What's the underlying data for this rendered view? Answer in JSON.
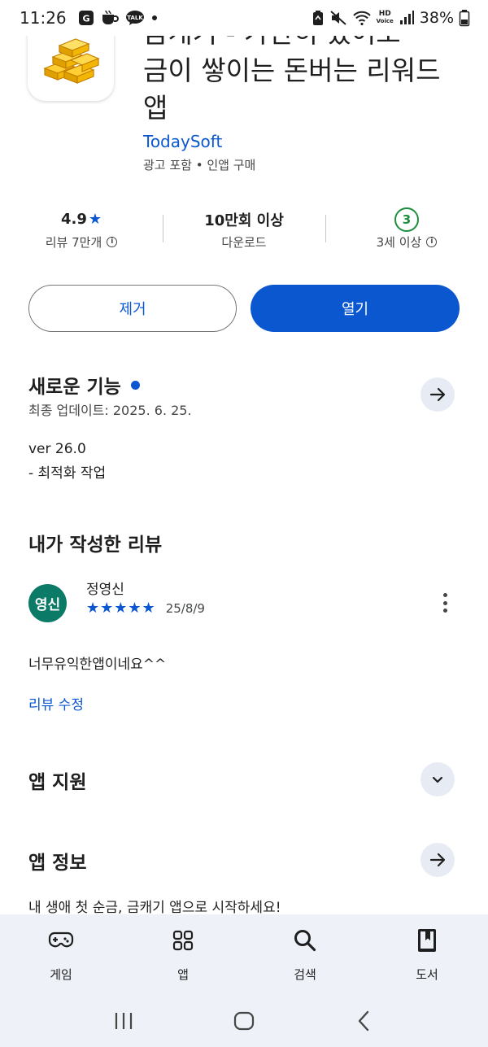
{
  "status_bar": {
    "time": "11:26",
    "notif_icons": [
      "gallery-icon",
      "coffee-icon",
      "talk-icon"
    ],
    "talk_badge": "TALK",
    "hd_badge_top": "HD",
    "hd_badge_bottom": "Voice",
    "battery_percent": "38%"
  },
  "app": {
    "title_line1": "금캐기 - 가만히 있어도",
    "title_line2": "금이 쌓이는 돈버는 리워드",
    "title_line3": "앱",
    "developer": "TodaySoft",
    "ad_info": "광고 포함 • 인앱 구매"
  },
  "stats": {
    "rating": "4.9",
    "rating_star": "★",
    "reviews_label": "리뷰 7만개",
    "downloads": "10만회 이상",
    "downloads_label": "다운로드",
    "age_rating": "3",
    "age_label": "3세 이상",
    "info_glyph": "i"
  },
  "buttons": {
    "remove": "제거",
    "open": "열기"
  },
  "whats_new": {
    "title": "새로운 기능",
    "last_updated": "최종 업데이트: 2025. 6. 25.",
    "version": "ver 26.0",
    "note": "- 최적화 작업"
  },
  "my_review": {
    "title": "내가 작성한 리뷰",
    "avatar_text": "영신",
    "reviewer": "정영신",
    "stars": "★★★★★",
    "rating_value": 5,
    "date": "25/8/9",
    "text": "너무유익한앱이네요^^",
    "edit_label": "리뷰 수정"
  },
  "app_support": {
    "title": "앱 지원"
  },
  "app_info": {
    "title": "앱 정보",
    "description": "내 생애 첫 순금, 금캐기 앱으로 시작하세요!"
  },
  "bottom_nav": [
    {
      "label": "게임",
      "icon": "gamepad-icon"
    },
    {
      "label": "앱",
      "icon": "apps-grid-icon"
    },
    {
      "label": "검색",
      "icon": "search-icon"
    },
    {
      "label": "도서",
      "icon": "book-icon"
    }
  ],
  "colors": {
    "accent": "#0b57d0",
    "age_green": "#1e8e3e",
    "avatar_bg": "#0b7a67",
    "nav_bg": "#eef1f7",
    "gold": "#f2b705"
  }
}
